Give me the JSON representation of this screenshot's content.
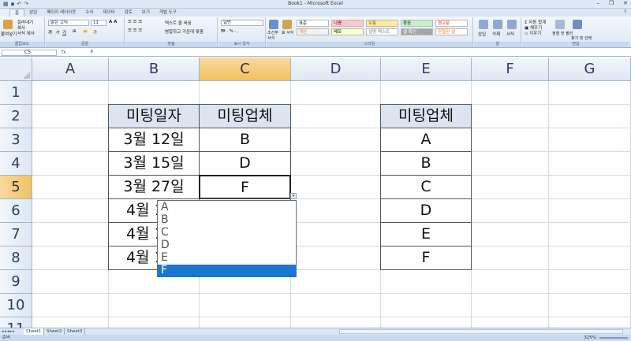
{
  "window": {
    "title": "Book1 - Microsoft Excel"
  },
  "qat_icons": [
    "excel-logo-icon",
    "save-icon",
    "undo-icon",
    "redo-icon"
  ],
  "window_controls": [
    "–",
    "❐",
    "✕"
  ],
  "tabs": [
    "홈",
    "삽입",
    "페이지 레이아웃",
    "수식",
    "데이터",
    "검토",
    "보기",
    "개발 도구"
  ],
  "ribbon": {
    "clipboard": {
      "paste": "붙여넣기",
      "cut": "잘라내기",
      "copy": "복사",
      "format_painter": "서식 복사",
      "label": "클립보드"
    },
    "font": {
      "name": "맑은 고딕",
      "size": "11",
      "label": "글꼴"
    },
    "alignment": {
      "wrap": "텍스트 줄 바꿈",
      "merge": "병합하고 가운데 맞춤",
      "label": "맞춤"
    },
    "number": {
      "format": "일반",
      "label": "표시 형식"
    },
    "styles": {
      "conditional": "조건부 서식",
      "table": "표 서식",
      "cells": [
        {
          "label": "표준",
          "bg": "#ffffff",
          "fg": "#000000"
        },
        {
          "label": "나쁨",
          "bg": "#ffc7ce",
          "fg": "#9c0006"
        },
        {
          "label": "보통",
          "bg": "#ffeb9c",
          "fg": "#9c6500"
        },
        {
          "label": "좋음",
          "bg": "#c6efce",
          "fg": "#006100"
        },
        {
          "label": "경고문",
          "bg": "#ffffff",
          "fg": "#ff0000"
        },
        {
          "label": "계산",
          "bg": "#f2f2f2",
          "fg": "#fa7d00"
        },
        {
          "label": "메모",
          "bg": "#ffffcc",
          "fg": "#000000"
        },
        {
          "label": "설명 텍스트",
          "bg": "#ffffff",
          "fg": "#7f7f7f"
        },
        {
          "label": "셀 확인",
          "bg": "#a5a5a5",
          "fg": "#ffffff"
        },
        {
          "label": "연결된 셀",
          "bg": "#ffffff",
          "fg": "#fa7d00"
        }
      ],
      "label": "스타일"
    },
    "cells": {
      "insert": "삽입",
      "delete": "삭제",
      "format": "서식",
      "label": "셀"
    },
    "editing": {
      "autosum": "자동 합계",
      "fill": "채우기",
      "clear": "지우기",
      "sort": "정렬 및 필터",
      "find": "찾기 및 선택",
      "label": "편집"
    }
  },
  "formula_bar": {
    "name_box": "C5",
    "fx": "fx",
    "content": "F"
  },
  "columns": [
    "A",
    "B",
    "C",
    "D",
    "E",
    "F",
    "G"
  ],
  "selected_column": "C",
  "rows": [
    "1",
    "2",
    "3",
    "4",
    "5",
    "6",
    "7",
    "8",
    "9",
    "10",
    "11"
  ],
  "selected_row": "5",
  "table1": {
    "headers": [
      "미팅일자",
      "미팅업체"
    ],
    "rows": [
      [
        "3월 12일",
        "B"
      ],
      [
        "3월 15일",
        "D"
      ],
      [
        "3월 27일",
        "F"
      ],
      [
        "4월 1",
        ""
      ],
      [
        "4월 1",
        ""
      ],
      [
        "4월 1",
        ""
      ]
    ]
  },
  "table2": {
    "header": "미팅업체",
    "values": [
      "A",
      "B",
      "C",
      "D",
      "E",
      "F"
    ]
  },
  "dropdown": {
    "options": [
      "A",
      "B",
      "C",
      "D",
      "E",
      "F"
    ],
    "highlighted": "F"
  },
  "sheets": [
    "Sheet1",
    "Sheet2",
    "Sheet3"
  ],
  "status": {
    "ready": "준비",
    "zoom": "325%"
  },
  "colors": {
    "accent": "#1b76d1",
    "header_fill": "#dbe5f1",
    "selected_header": "#f9d99f"
  }
}
